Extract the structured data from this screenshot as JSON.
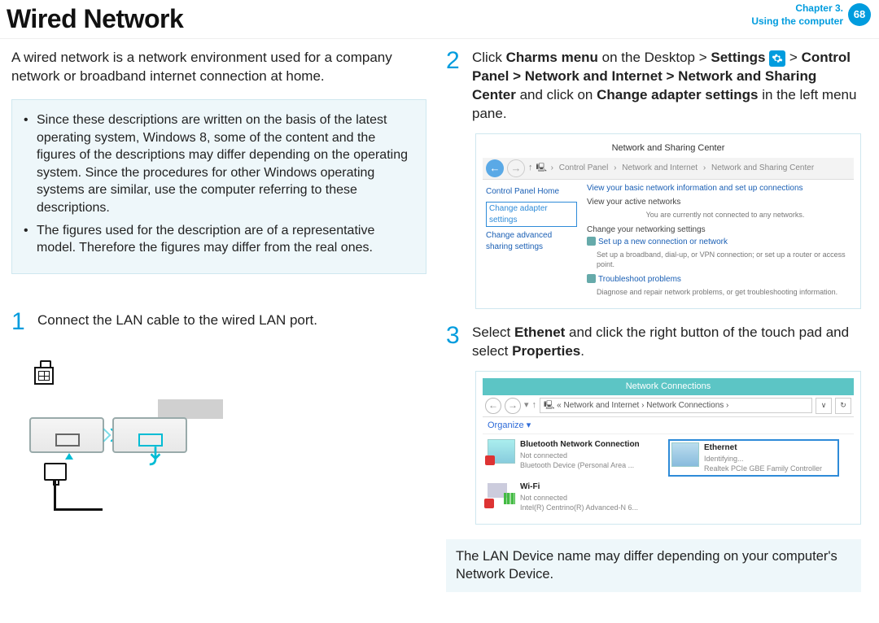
{
  "header": {
    "title": "Wired Network",
    "chapter_line1": "Chapter 3.",
    "chapter_line2": "Using the computer",
    "page": "68"
  },
  "intro": "A wired network is a network environment used for a company network or broadband internet connection at home.",
  "note_bullets": [
    "Since these descriptions are written on the basis of the latest operating system, Windows 8, some of the content and the figures of the descriptions may differ depending on the operating system. Since the procedures for other Windows operating systems are similar, use the computer referring to these descriptions.",
    "The figures used for the description are of a representative model. Therefore the figures may differ from the real ones."
  ],
  "steps": {
    "s1": {
      "num": "1",
      "text": "Connect the LAN cable to the wired LAN port."
    },
    "s2": {
      "num": "2",
      "t1": "Click ",
      "b1": "Charms menu",
      "t2": " on the Desktop > ",
      "b2": "Settings",
      "t3": " > ",
      "b3": "Control Panel > Network and Internet > Network and Sharing Center",
      "t4": " and click on ",
      "b4": "Change adapter settings",
      "t5": " in the left menu pane."
    },
    "s3": {
      "num": "3",
      "t1": "Select ",
      "b1": "Ethenet",
      "t2": " and click the right button of the touch pad and select ",
      "b2": "Properties",
      "t3": "."
    }
  },
  "shot1": {
    "title": "Network and Sharing Center",
    "crumb_cp": "Control Panel",
    "crumb_ni": "Network and Internet",
    "crumb_ns": "Network and Sharing Center",
    "side_home": "Control Panel Home",
    "side_change": "Change adapter settings",
    "side_adv": "Change advanced sharing settings",
    "main_head": "View your basic network information and set up connections",
    "active": "View your active networks",
    "active_sub": "You are currently not connected to any networks.",
    "change_net": "Change your networking settings",
    "setup": "Set up a new connection or network",
    "setup_sub": "Set up a broadband, dial-up, or VPN connection; or set up a router or access point.",
    "trouble": "Troubleshoot problems",
    "trouble_sub": "Diagnose and repair network problems, or get troubleshooting information."
  },
  "shot2": {
    "title": "Network Connections",
    "path1": "Network and Internet",
    "path2": "Network Connections",
    "organize": "Organize ▾",
    "bt_name": "Bluetooth Network Connection",
    "bt_status": "Not connected",
    "bt_dev": "Bluetooth Device (Personal Area ...",
    "eth_name": "Ethernet",
    "eth_status": "Identifying...",
    "eth_dev": "Realtek PCIe GBE Family Controller",
    "wifi_name": "Wi-Fi",
    "wifi_status": "Not connected",
    "wifi_dev": "Intel(R) Centrino(R) Advanced-N 6..."
  },
  "note_strip": "The LAN Device name may differ depending on your computer's Network Device."
}
